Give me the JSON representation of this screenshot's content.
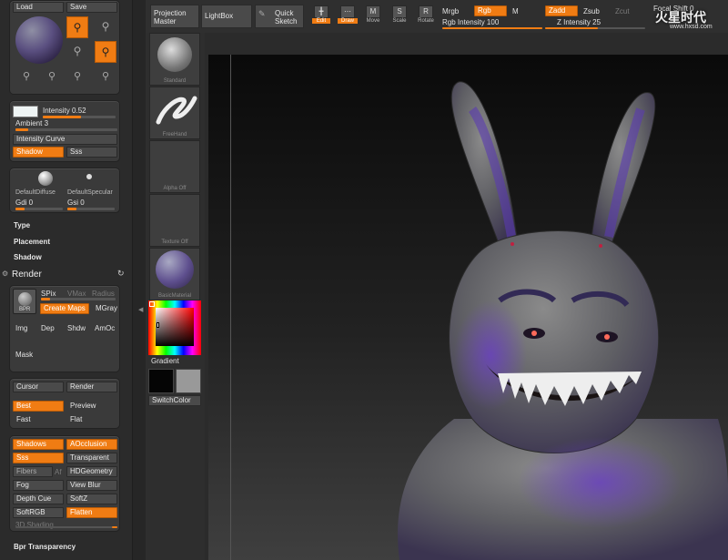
{
  "lighting": {
    "load": "Load",
    "save": "Save",
    "intensity": "Intensity 0.52",
    "intensity_val": 0.52,
    "ambient": "Ambient 3",
    "ambient_val": 0.03,
    "intensity_curve": "Intensity Curve",
    "shadow": "Shadow",
    "sss": "Sss"
  },
  "materials": {
    "default_diffuse": "DefaultDiffuse",
    "default_specular": "DefaultSpecular",
    "gdi": "Gdi 0",
    "gsi": "Gsi 0"
  },
  "sections": {
    "type": "Type",
    "placement": "Placement",
    "shadow": "Shadow",
    "render": "Render",
    "bpr_transparency": "Bpr Transparency"
  },
  "render": {
    "bpr": "BPR",
    "spix": "SPix",
    "vmax": "VMax",
    "radius": "Radius",
    "create_maps": "Create Maps",
    "mgray": "MGray",
    "img": "Img",
    "dep": "Dep",
    "shdw": "Shdw",
    "amoc": "AmOc",
    "mask": "Mask",
    "cursor": "Cursor",
    "render": "Render",
    "best": "Best",
    "preview": "Preview",
    "fast": "Fast",
    "flat": "Flat"
  },
  "render_props": {
    "shadows": "Shadows",
    "aocclusion": "AOcclusion",
    "sss": "Sss",
    "transparent": "Transparent",
    "fibers": "Fibers",
    "af": "Af",
    "hdgeometry": "HDGeometry",
    "fog": "Fog",
    "view_blur": "View Blur",
    "depth_cue": "Depth Cue",
    "softz": "SoftZ",
    "softrgb": "SoftRGB",
    "flatten": "Flatten",
    "shading_3d": "3D Shading"
  },
  "tray": {
    "standard": "Standard",
    "freehand": "FreeHand",
    "alpha": "Alpha Off",
    "texture": "Texture Off",
    "material": "BasicMaterial",
    "gradient": "Gradient",
    "switch_color": "SwitchColor"
  },
  "topbar": {
    "projection_master": "Projection Master",
    "lightbox": "LightBox",
    "quick_sketch": "Quick Sketch",
    "edit": "Edit",
    "draw": "Draw",
    "move": "Move",
    "scale": "Scale",
    "rotate": "Rotate",
    "mrgb": "Mrgb",
    "rgb": "Rgb",
    "m": "M",
    "rgb_intensity": "Rgb Intensity 100",
    "zadd": "Zadd",
    "zsub": "Zsub",
    "zcut": "Zcut",
    "z_intensity": "Z Intensity 25",
    "focal_shift": "Focal Shift 0",
    "watermark": "www.hxsd.com",
    "watermark_logo": "火星时代"
  }
}
